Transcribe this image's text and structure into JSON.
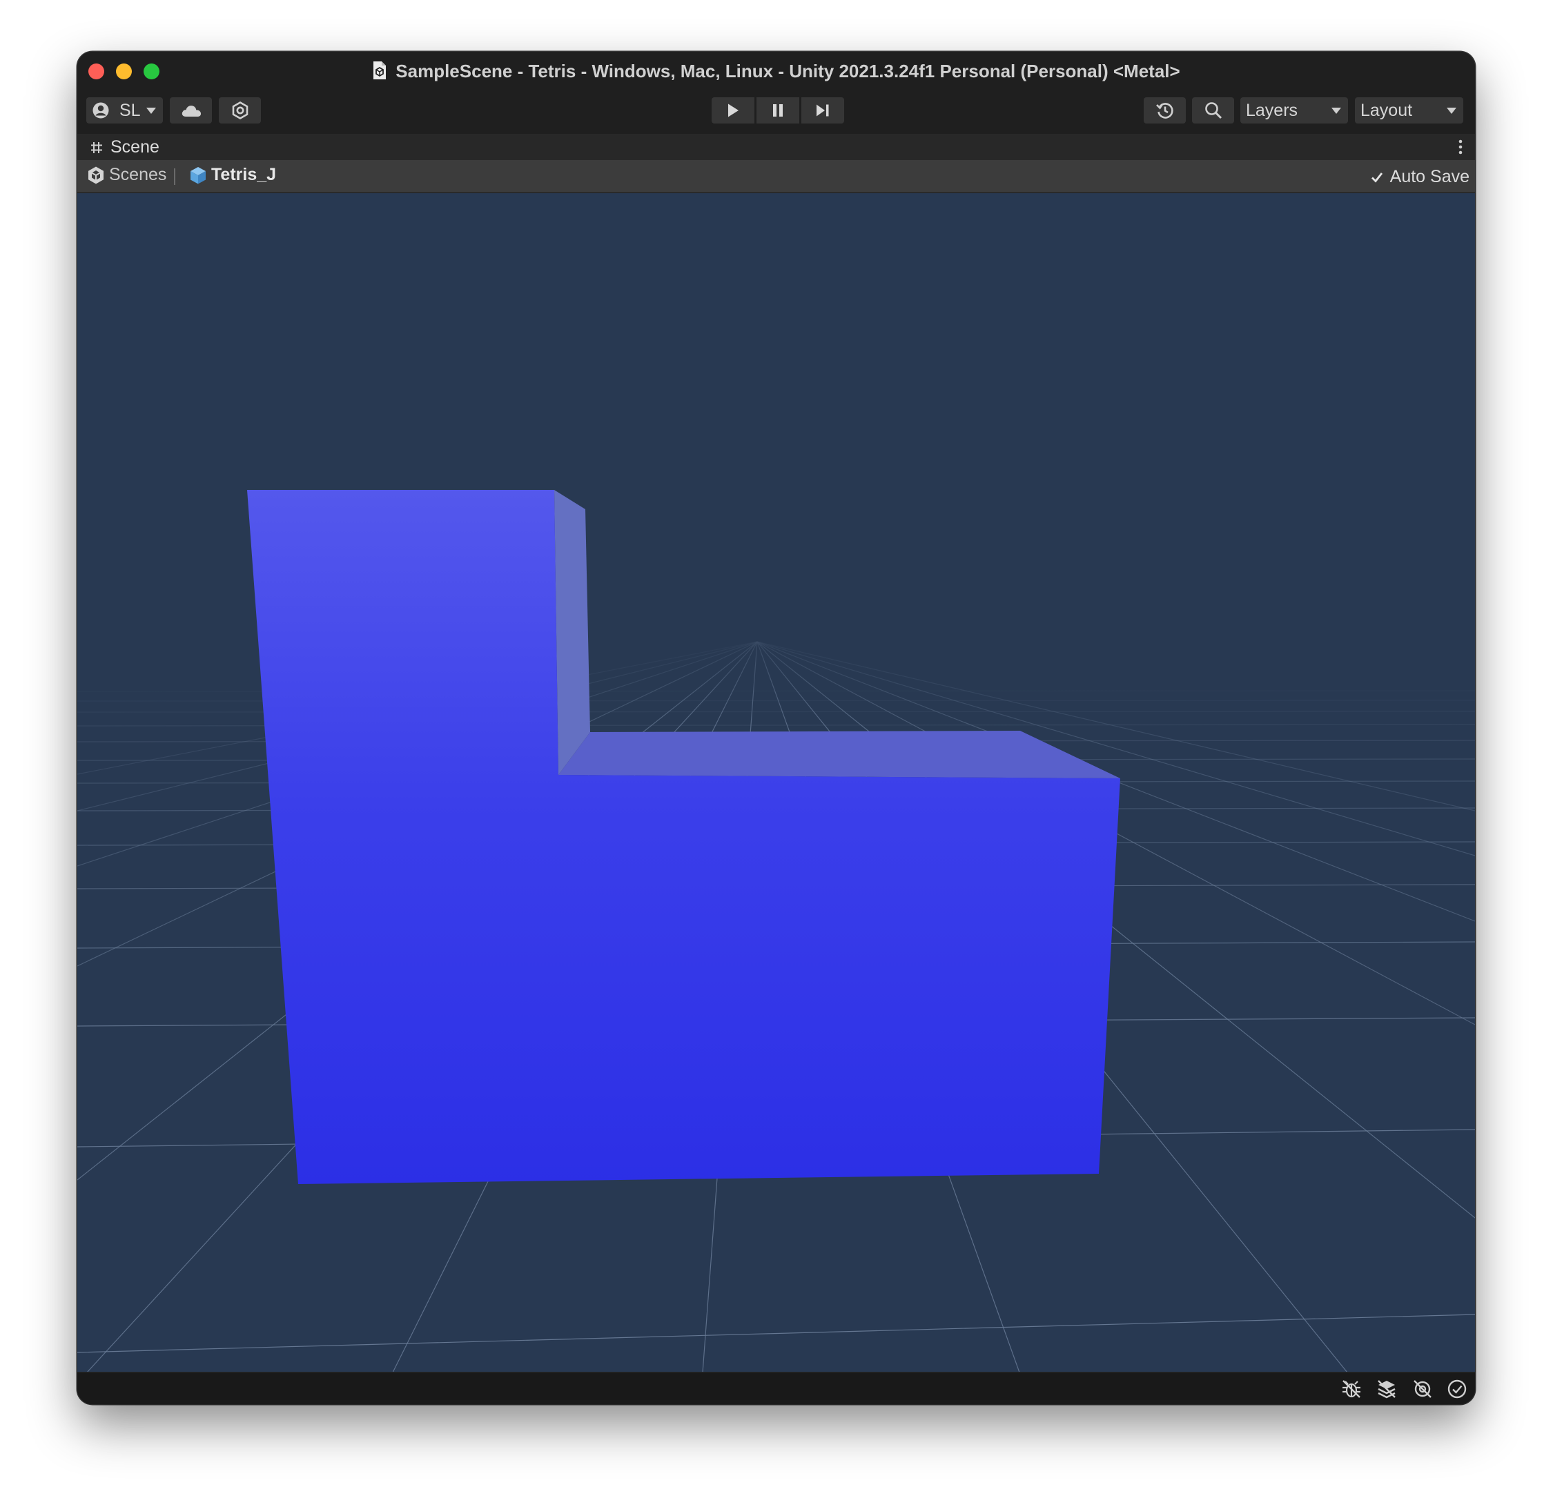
{
  "window": {
    "title": "SampleScene - Tetris - Windows, Mac, Linux - Unity 2021.3.24f1 Personal (Personal) <Metal>"
  },
  "toolbar": {
    "account_label": "SL",
    "layers_label": "Layers",
    "layout_label": "Layout",
    "icons": [
      "account-icon",
      "cloud-icon",
      "collab-icon",
      "play-icon",
      "pause-icon",
      "step-icon",
      "history-icon",
      "search-icon"
    ]
  },
  "scene_tab": {
    "title": "Scene"
  },
  "breadcrumb": {
    "root": "Scenes",
    "current": "Tetris_J"
  },
  "auto_save": {
    "label": "Auto Save",
    "checked": true
  },
  "viewport": {
    "background_color": "#283952",
    "object_color": "#3c3fe8",
    "object_name": "Tetris_J"
  },
  "status_icons": [
    "debug-icon",
    "layers-stack-icon",
    "hidden-icon",
    "check-circle-icon"
  ]
}
